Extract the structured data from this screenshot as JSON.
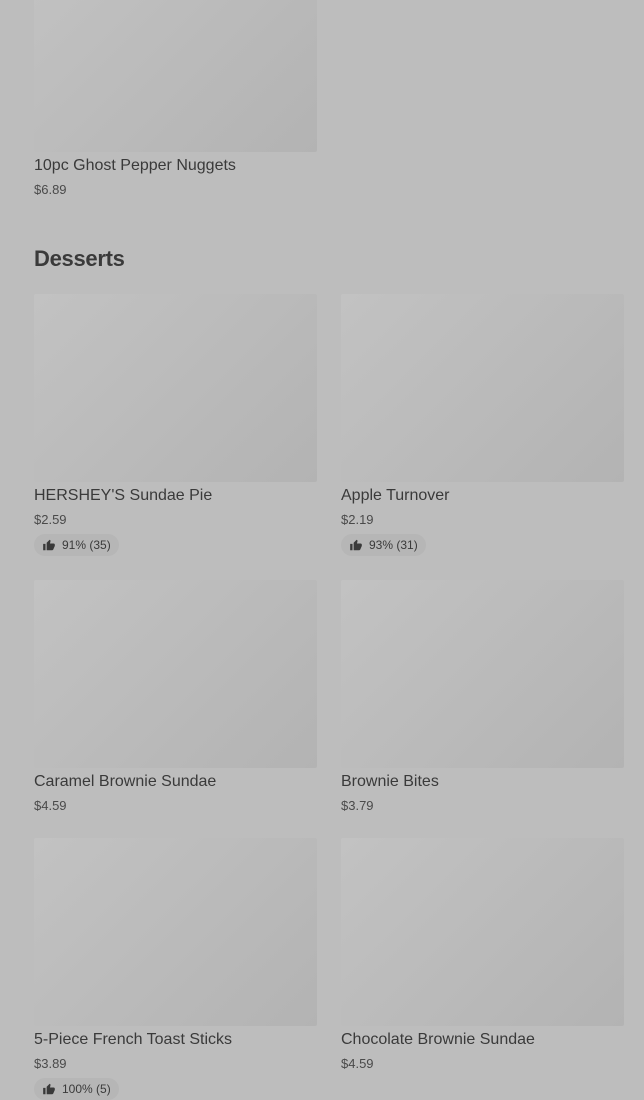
{
  "previous_section": {
    "item": {
      "name": "10pc Ghost Pepper Nuggets",
      "price": "$6.89"
    }
  },
  "desserts": {
    "title": "Desserts",
    "items": [
      {
        "name": "HERSHEY'S Sundae Pie",
        "price": "$2.59",
        "rating": "91% (35)"
      },
      {
        "name": "Apple Turnover",
        "price": "$2.19",
        "rating": "93% (31)"
      },
      {
        "name": "Caramel Brownie Sundae",
        "price": "$4.59"
      },
      {
        "name": "Brownie Bites",
        "price": "$3.79"
      },
      {
        "name": "5-Piece French Toast Sticks",
        "price": "$3.89",
        "rating": "100% (5)"
      },
      {
        "name": "Chocolate Brownie Sundae",
        "price": "$4.59"
      }
    ]
  },
  "icons": {
    "rating": "thumbs-up-icon"
  },
  "colors": {
    "background": "#bdbdbd",
    "text": "#3a3a3a",
    "placeholder": "#b8b8b8"
  }
}
